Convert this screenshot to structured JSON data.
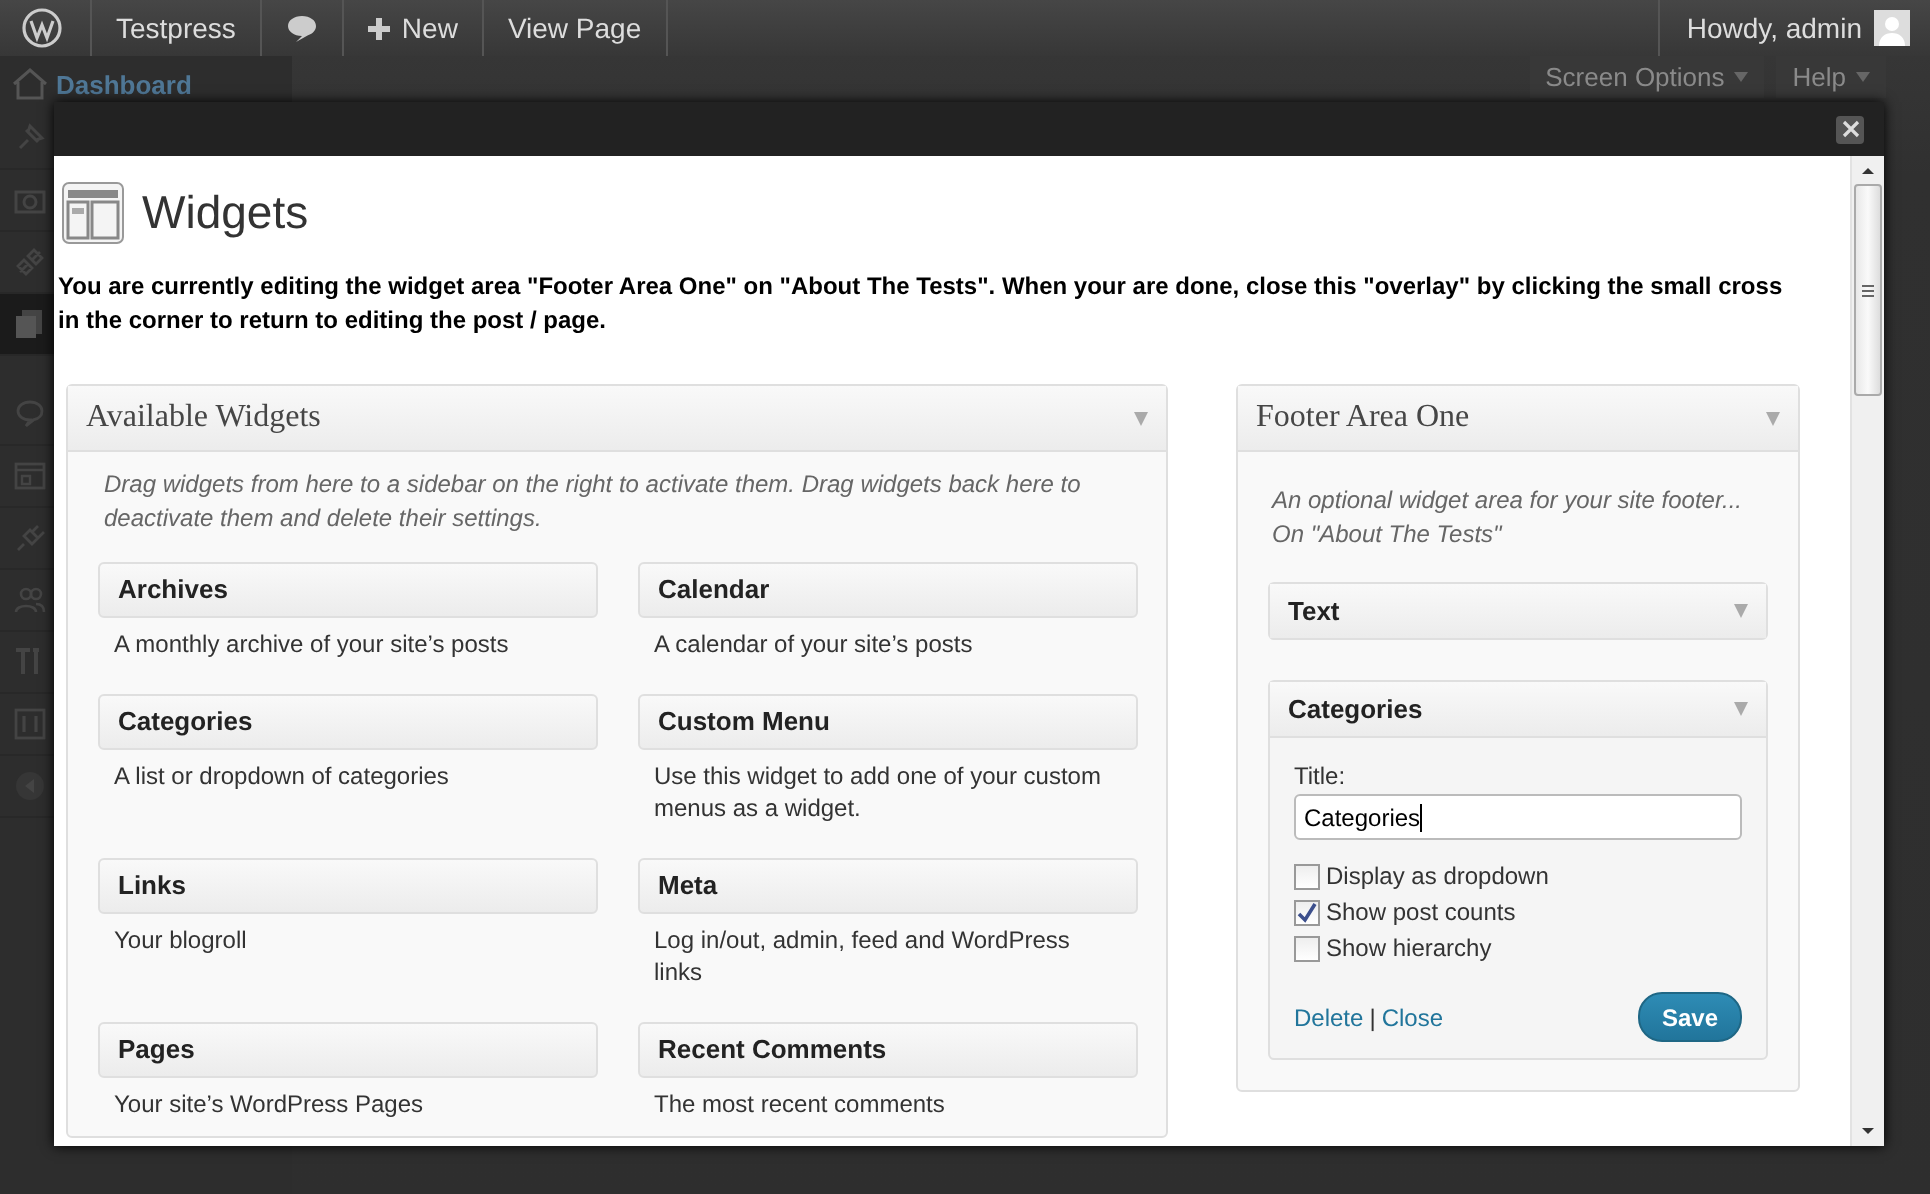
{
  "admin_bar": {
    "site": "Testpress",
    "new": "New",
    "view": "View Page",
    "greeting": "Howdy, admin"
  },
  "background": {
    "menu_item": "Dashboard",
    "screen_options": "Screen Options",
    "help": "Help"
  },
  "modal": {
    "title": "Widgets",
    "notice": "You are currently editing the widget area \"Footer Area One\" on \"About The Tests\". When your are done, close this \"overlay\" by clicking the small cross in the corner to return to editing the post / page.",
    "available": {
      "title": "Available Widgets",
      "description": "Drag widgets from here to a sidebar on the right to activate them. Drag widgets back here to deactivate them and delete their settings.",
      "widgets": [
        {
          "name": "Archives",
          "description": "A monthly archive of your site’s posts"
        },
        {
          "name": "Calendar",
          "description": "A calendar of your site’s posts"
        },
        {
          "name": "Categories",
          "description": "A list or dropdown of categories"
        },
        {
          "name": "Custom Menu",
          "description": "Use this widget to add one of your custom menus as a widget."
        },
        {
          "name": "Links",
          "description": "Your blogroll"
        },
        {
          "name": "Meta",
          "description": "Log in/out, admin, feed and WordPress links"
        },
        {
          "name": "Pages",
          "description": "Your site’s WordPress Pages"
        },
        {
          "name": "Recent Comments",
          "description": "The most recent comments"
        }
      ]
    },
    "sidebar": {
      "title": "Footer Area One",
      "description": "An optional widget area for your site footer...\nOn \"About The Tests\"",
      "widgets": [
        {
          "name": "Text",
          "expanded": false
        },
        {
          "name": "Categories",
          "expanded": true,
          "title_label": "Title:",
          "title_value": "Categories",
          "options": [
            {
              "label": "Display as dropdown",
              "checked": false
            },
            {
              "label": "Show post counts",
              "checked": true
            },
            {
              "label": "Show hierarchy",
              "checked": false
            }
          ],
          "delete": "Delete",
          "separator": "|",
          "close": "Close",
          "save": "Save"
        }
      ]
    }
  }
}
